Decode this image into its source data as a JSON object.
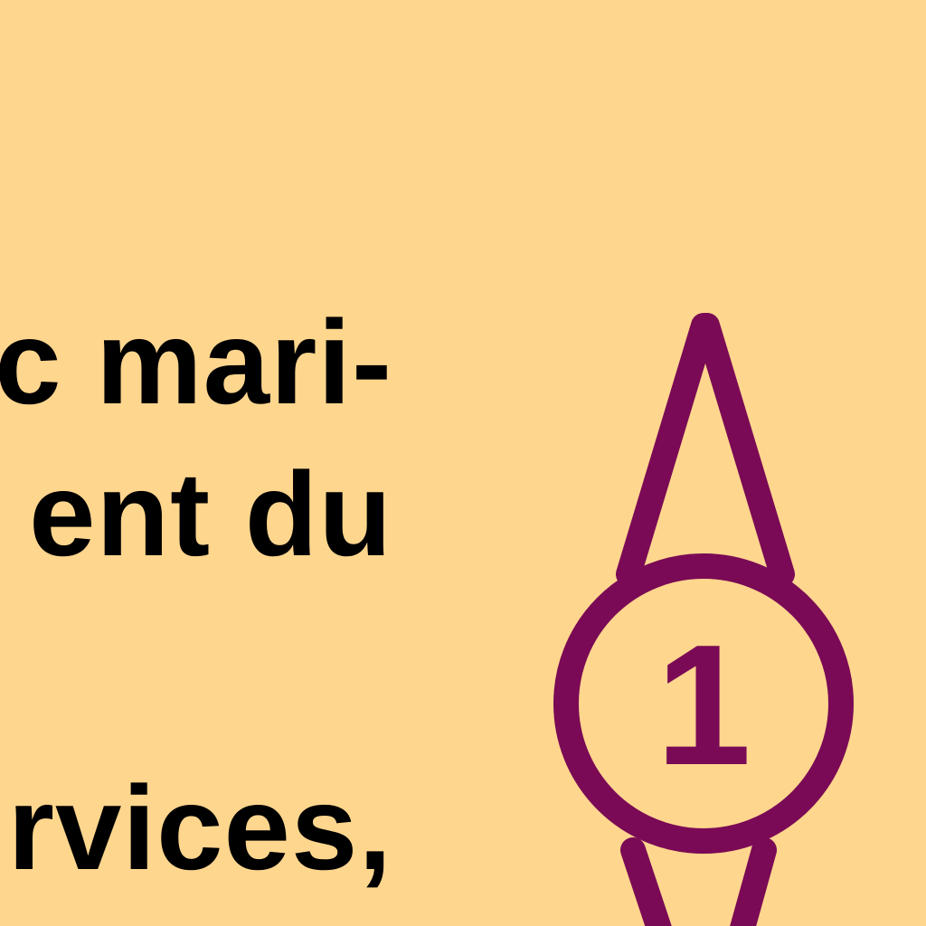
{
  "text_lines": [
    "c mari-",
    "ent du",
    "rvices,"
  ],
  "marker": {
    "number": "1",
    "color": "#7A0A55"
  },
  "colors": {
    "background": "#FFD68E",
    "text": "#000000"
  }
}
